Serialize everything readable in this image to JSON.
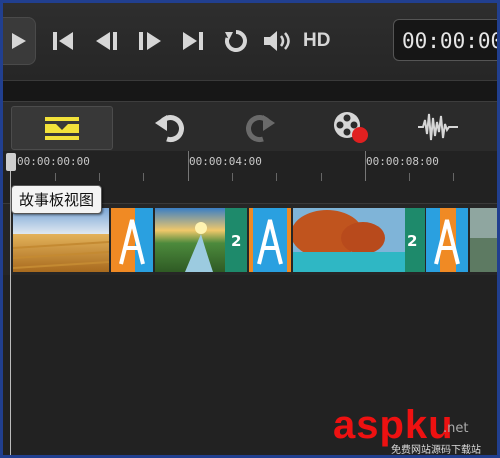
{
  "transport": {
    "hd_label": "HD",
    "timecode": "00:00:00:"
  },
  "toolbar": {
    "icons": [
      "storyboard-icon",
      "undo-icon",
      "redo-icon",
      "record-icon",
      "audio-icon"
    ]
  },
  "ruler": {
    "labels": [
      "00:00:00:00",
      "00:00:04:00",
      "00:00:08:00"
    ]
  },
  "tooltip": {
    "text": "故事板视图"
  },
  "storyboard": {
    "transition_numbers": [
      "2",
      "2"
    ]
  },
  "watermark": {
    "brand": "aspku",
    "net": ".net",
    "sub": "免费网站源码下载站"
  },
  "colors": {
    "accent_yellow": "#f2e23a",
    "record_red": "#e02020",
    "transition_teal": "#1e8a6b",
    "transition_orange": "#f08a24",
    "transition_blue": "#2aa0e0",
    "frame_blue": "#213f8f"
  }
}
